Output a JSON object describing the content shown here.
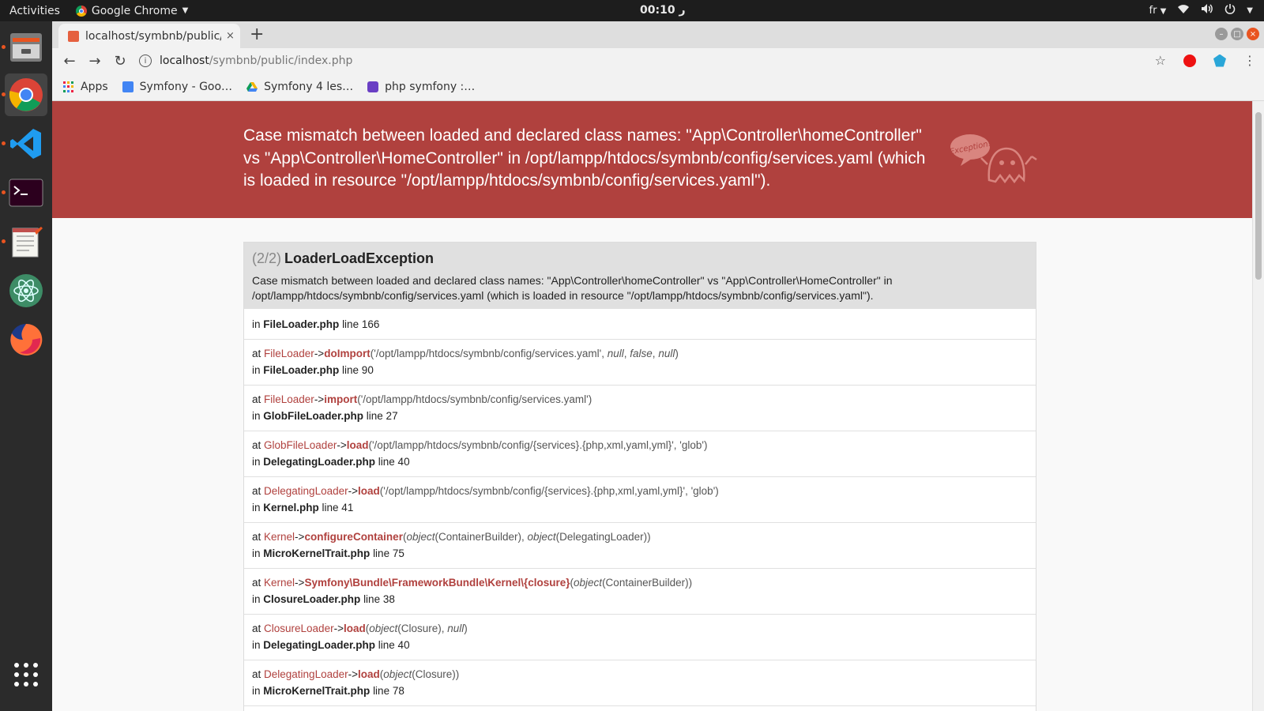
{
  "topbar": {
    "activities": "Activities",
    "app_name": "Google Chrome",
    "clock": "00:10 ر",
    "lang": "fr"
  },
  "dock": {
    "items": [
      "files-icon",
      "chrome-icon",
      "vscode-icon",
      "terminal-icon",
      "text-editor-icon",
      "atom-icon",
      "firefox-icon",
      "app-grid-icon"
    ]
  },
  "tab": {
    "title": "localhost/symbnb/public/",
    "close": "×",
    "new": "+"
  },
  "toolbar": {
    "host": "localhost",
    "path": "/symbnb/public/index.php"
  },
  "bookmarks": [
    {
      "label": "Apps"
    },
    {
      "label": "Symfony - Goo…"
    },
    {
      "label": "Symfony 4 les…"
    },
    {
      "label": "php symfony :…"
    }
  ],
  "banner": {
    "message": "Case mismatch between loaded and declared class names: \"App\\Controller\\homeController\" vs \"App\\Controller\\HomeController\" in /opt/lampp/htdocs/symbnb/config/services.yaml (which is loaded in resource \"/opt/lampp/htdocs/symbnb/config/services.yaml\").",
    "badge": "Exception!"
  },
  "exception": {
    "index": "(2/2)",
    "class": "LoaderLoadException",
    "message": "Case mismatch between loaded and declared class names: \"App\\Controller\\homeController\" vs \"App\\Controller\\HomeController\" in /opt/lampp/htdocs/symbnb/config/services.yaml (which is loaded in resource \"/opt/lampp/htdocs/symbnb/config/services.yaml\").",
    "first": {
      "in": "in",
      "file": "FileLoader.php",
      "line": "line 166"
    },
    "trace": [
      {
        "cls": "FileLoader",
        "fn": "doImport",
        "args_html": "('/opt/lampp/htdocs/symbnb/config/services.yaml', <em>null</em>, <em>false</em>, <em>null</em>)",
        "file": "FileLoader.php",
        "line": "line 90"
      },
      {
        "cls": "FileLoader",
        "fn": "import",
        "args_html": "('/opt/lampp/htdocs/symbnb/config/services.yaml')",
        "file": "GlobFileLoader.php",
        "line": "line 27"
      },
      {
        "cls": "GlobFileLoader",
        "fn": "load",
        "args_html": "('/opt/lampp/htdocs/symbnb/config/{services}.{php,xml,yaml,yml}', 'glob')",
        "file": "DelegatingLoader.php",
        "line": "line 40"
      },
      {
        "cls": "DelegatingLoader",
        "fn": "load",
        "args_html": "('/opt/lampp/htdocs/symbnb/config/{services}.{php,xml,yaml,yml}', 'glob')",
        "file": "Kernel.php",
        "line": "line 41"
      },
      {
        "cls": "Kernel",
        "fn": "configureContainer",
        "args_html": "(<em>object</em>(ContainerBuilder), <em>object</em>(DelegatingLoader))",
        "file": "MicroKernelTrait.php",
        "line": "line 75"
      },
      {
        "cls": "Kernel",
        "fn": "Symfony\\Bundle\\FrameworkBundle\\Kernel\\{closure}",
        "args_html": "(<em>object</em>(ContainerBuilder))",
        "file": "ClosureLoader.php",
        "line": "line 38"
      },
      {
        "cls": "ClosureLoader",
        "fn": "load",
        "args_html": "(<em>object</em>(Closure), <em>null</em>)",
        "file": "DelegatingLoader.php",
        "line": "line 40"
      },
      {
        "cls": "DelegatingLoader",
        "fn": "load",
        "args_html": "(<em>object</em>(Closure))",
        "file": "MicroKernelTrait.php",
        "line": "line 78"
      }
    ]
  }
}
